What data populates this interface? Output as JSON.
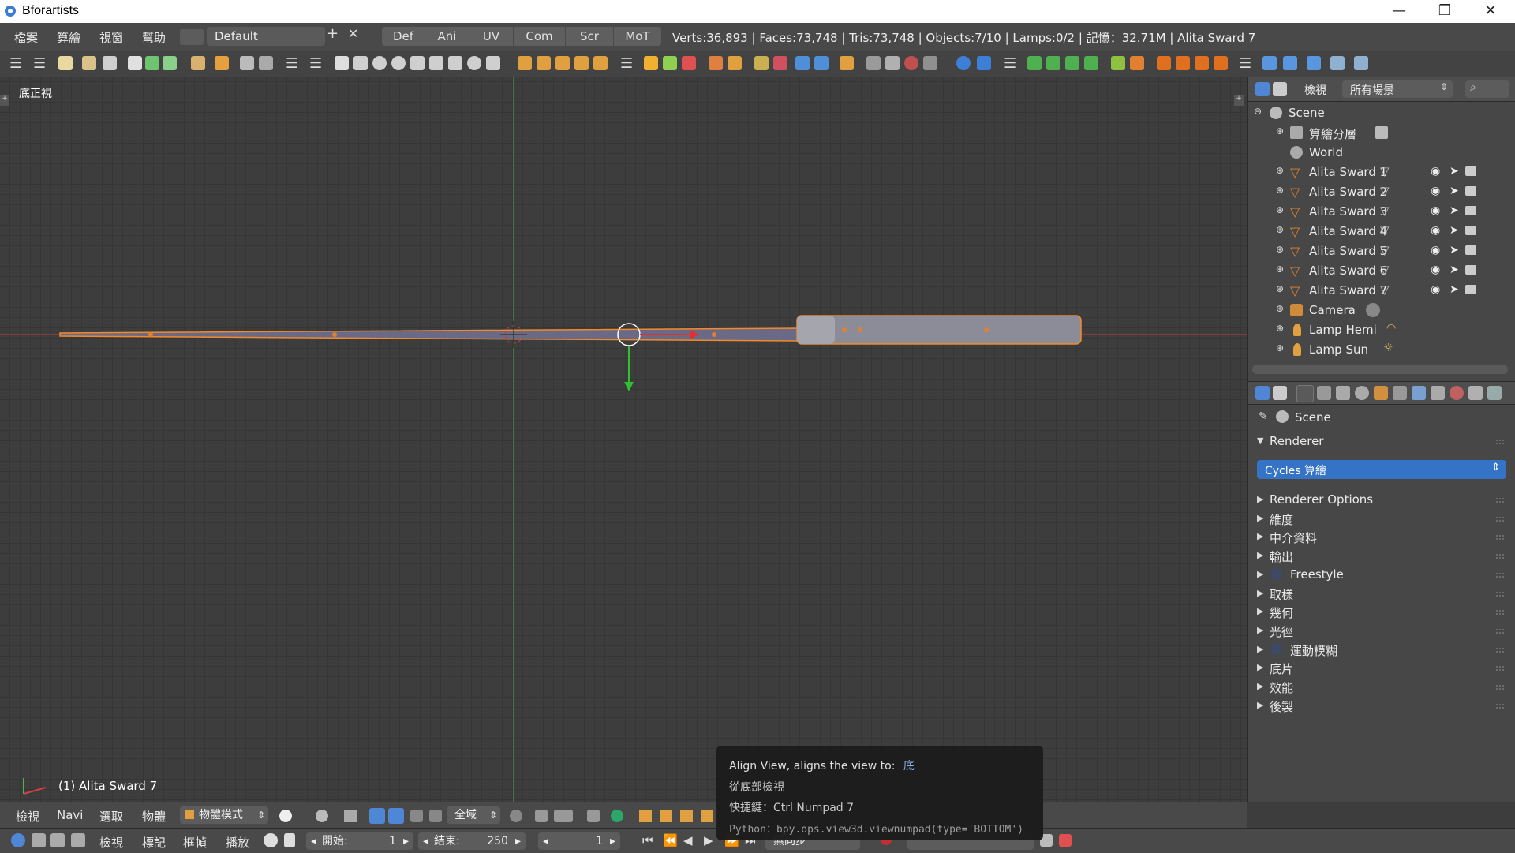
{
  "window": {
    "title": "Bforartists",
    "minimize": "—",
    "maximize": "❐",
    "close": "✕"
  },
  "menu": [
    "檔案",
    "算繪",
    "視窗",
    "幫助"
  ],
  "screen_layout": "Default",
  "workspace_tabs": [
    "Def",
    "Ani",
    "UV",
    "Com",
    "Scr",
    "MoT"
  ],
  "stats": "Verts:36,893 | Faces:73,748 | Tris:73,748 | Objects:7/10 | Lamps:0/2 | 記憶：32.71M | Alita Sward 7",
  "viewport": {
    "view_label": "底正視",
    "object_label": "(1) Alita Sward 7"
  },
  "outliner": {
    "view_menu": "檢視",
    "scene_filter": "所有場景",
    "root": "Scene",
    "render_layers": "算繪分層",
    "world": "World",
    "objects": [
      "Alita Sward 1",
      "Alita Sward 2",
      "Alita Sward 3",
      "Alita Sward 4",
      "Alita Sward 5",
      "Alita Sward 6",
      "Alita Sward 7"
    ],
    "camera": "Camera",
    "lamps": [
      "Lamp Hemi",
      "Lamp Sun"
    ]
  },
  "properties": {
    "context": "Scene",
    "renderer_header": "Renderer",
    "engine": "Cycles 算繪",
    "panels": [
      "Renderer Options",
      "維度",
      "中介資料",
      "輸出",
      "Freestyle",
      "取樣",
      "幾何",
      "光徑",
      "運動模糊",
      "底片",
      "效能",
      "後製"
    ]
  },
  "viewport_header": {
    "menus": [
      "檢視",
      "Navi",
      "選取",
      "物體"
    ],
    "mode": "物體模式",
    "orientation": "全域"
  },
  "timeline": {
    "menus": [
      "檢視",
      "標記",
      "框幀",
      "播放"
    ],
    "start_label": "開始:",
    "start": "1",
    "end_label": "結束:",
    "end": "250",
    "current": "1",
    "sync": "無同步"
  },
  "tooltip": {
    "title": "Align View, aligns the view to:",
    "value": "底",
    "description": "從底部檢視",
    "shortcut": "快捷鍵：Ctrl Numpad 7",
    "python": "Python：bpy.ops.view3d.viewnumpad(type='BOTTOM')"
  },
  "colors": {
    "accent": "#ff7b00",
    "x_axis": "#c43c3c",
    "y_axis": "#5fa35f",
    "selected_outline": "#f28a2c"
  }
}
